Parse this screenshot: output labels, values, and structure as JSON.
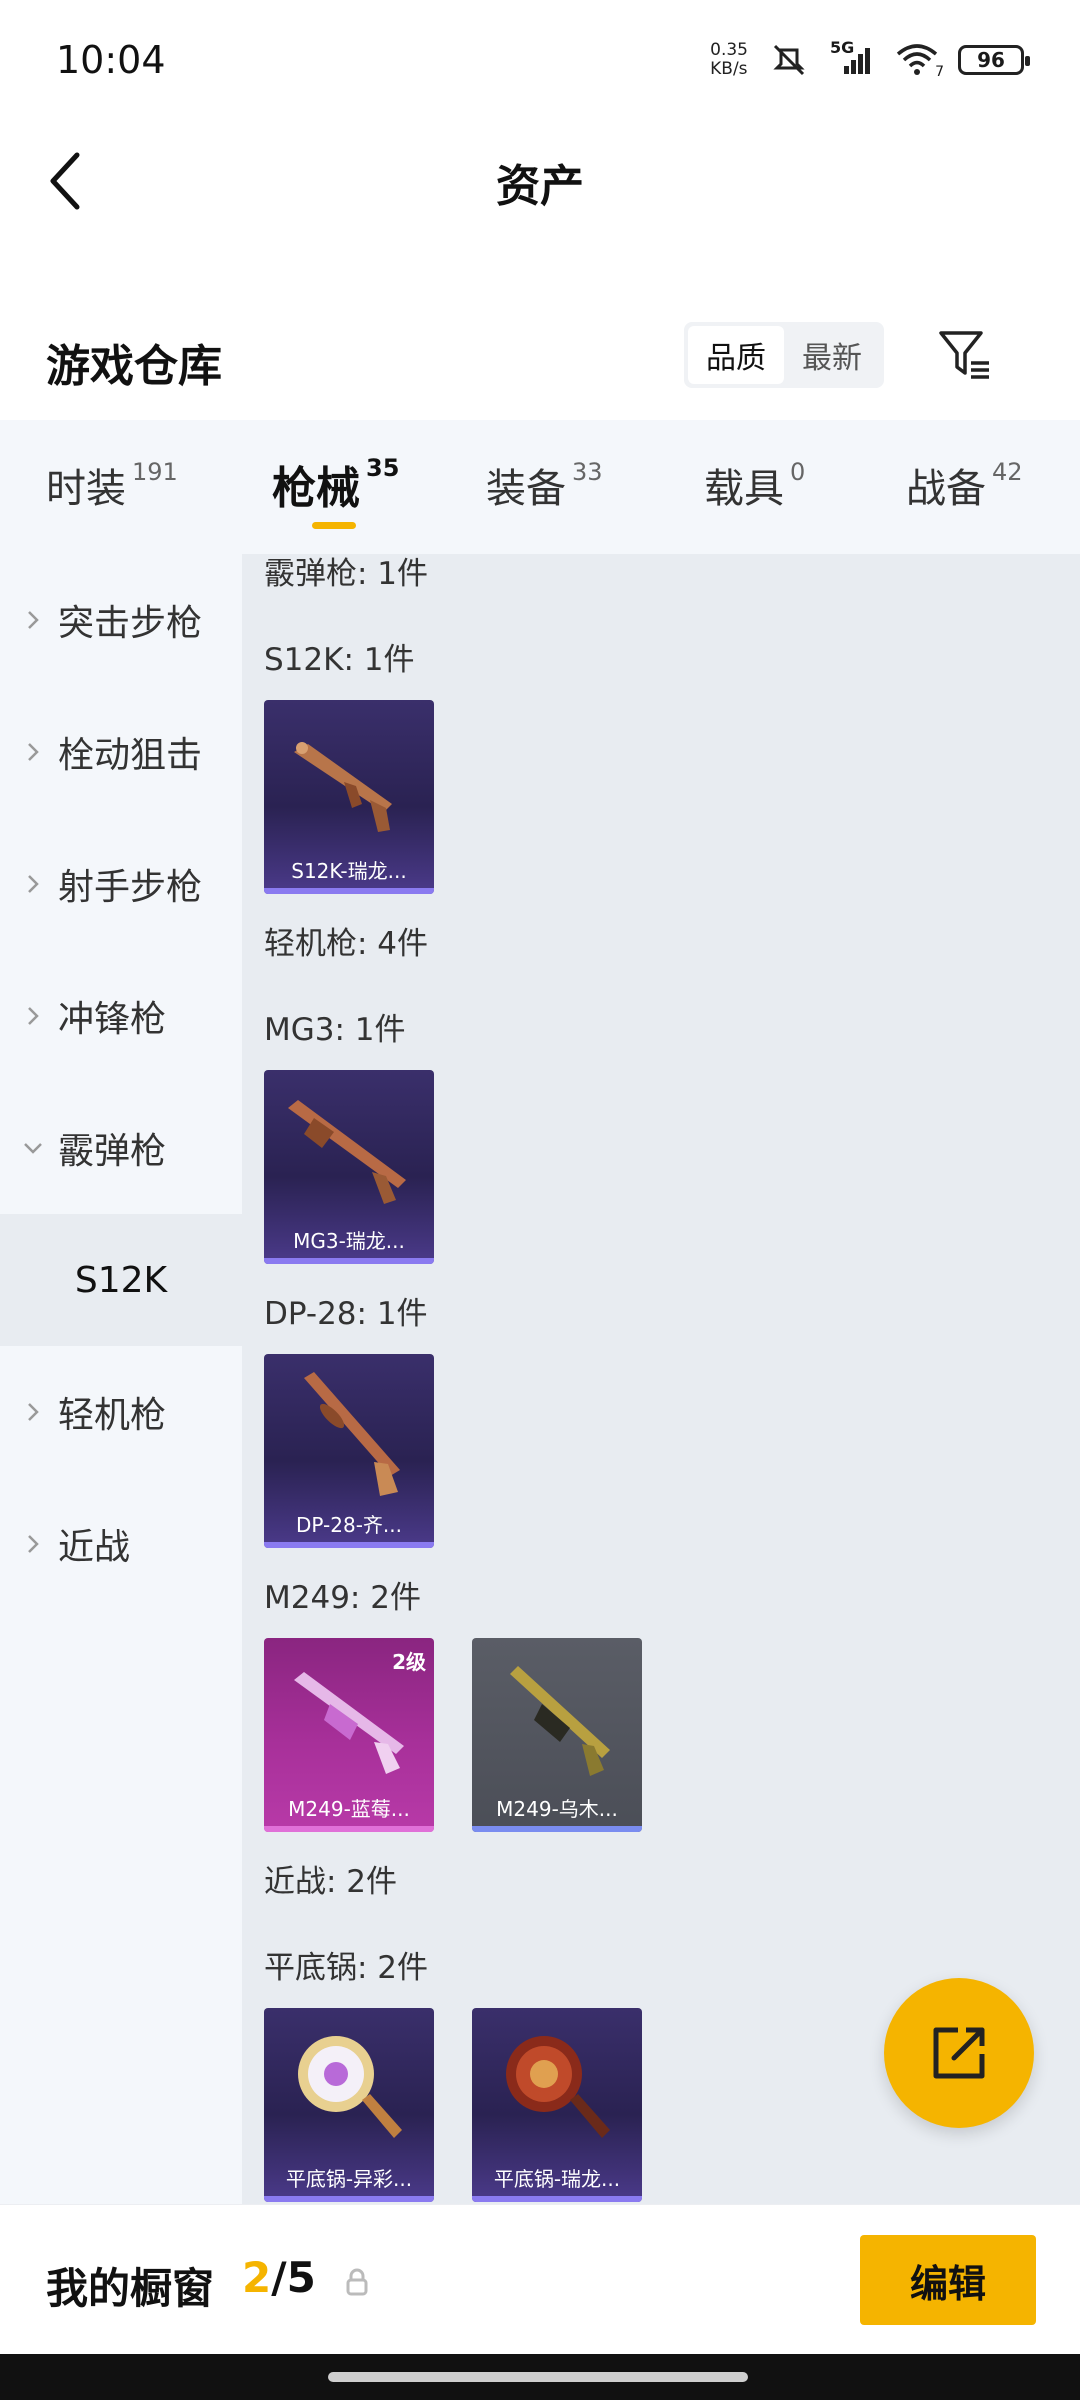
{
  "status": {
    "time": "10:04",
    "net_speed_value": "0.35",
    "net_speed_unit": "KB/s",
    "signal_label": "5G",
    "wifi_sub": "7",
    "battery": "96"
  },
  "header": {
    "title": "资产"
  },
  "warehouse": {
    "title": "游戏仓库",
    "sort_options": [
      "品质",
      "最新"
    ],
    "sort_active": "品质"
  },
  "category_tabs": [
    {
      "label": "时装",
      "count": "191"
    },
    {
      "label": "枪械",
      "count": "35",
      "active": true
    },
    {
      "label": "装备",
      "count": "33"
    },
    {
      "label": "载具",
      "count": "0"
    },
    {
      "label": "战备",
      "count": "42"
    }
  ],
  "sidebar": {
    "items": [
      {
        "label": "突击步枪"
      },
      {
        "label": "栓动狙击"
      },
      {
        "label": "射手步枪"
      },
      {
        "label": "冲锋枪"
      },
      {
        "label": "霰弹枪",
        "expanded": true
      },
      {
        "label": "S12K",
        "sub": true
      },
      {
        "label": "轻机枪"
      },
      {
        "label": "近战"
      }
    ]
  },
  "content": {
    "sections": [
      {
        "label": "霰弹枪: 1件"
      },
      {
        "label": "S12K: 1件"
      },
      {
        "label": "轻机枪: 4件"
      },
      {
        "label": "MG3: 1件"
      },
      {
        "label": "DP-28: 1件"
      },
      {
        "label": "M249: 2件"
      },
      {
        "label": "近战: 2件"
      },
      {
        "label": "平底锅: 2件"
      }
    ],
    "cards": [
      {
        "label": "S12K-瑞龙...",
        "style": "purple",
        "icon": "shotgun-icon"
      },
      {
        "label": "MG3-瑞龙...",
        "style": "purple",
        "icon": "machine-gun-icon"
      },
      {
        "label": "DP-28-齐...",
        "style": "purple",
        "icon": "machine-gun-icon"
      },
      {
        "label": "M249-蓝莓...",
        "style": "pink",
        "icon": "machine-gun-icon",
        "badge": "2级"
      },
      {
        "label": "M249-乌木...",
        "style": "gray",
        "icon": "machine-gun-icon"
      },
      {
        "label": "平底锅-异彩...",
        "style": "purple",
        "icon": "pan-icon"
      },
      {
        "label": "平底锅-瑞龙...",
        "style": "purple",
        "icon": "pan-icon"
      }
    ]
  },
  "bottom": {
    "showcase_label": "我的橱窗",
    "showcase_current": "2",
    "showcase_total": "/5",
    "edit_label": "编辑"
  },
  "colors": {
    "accent": "#f5b400",
    "panel_bg": "#f4f7fb",
    "content_bg": "#e8ecf1"
  }
}
